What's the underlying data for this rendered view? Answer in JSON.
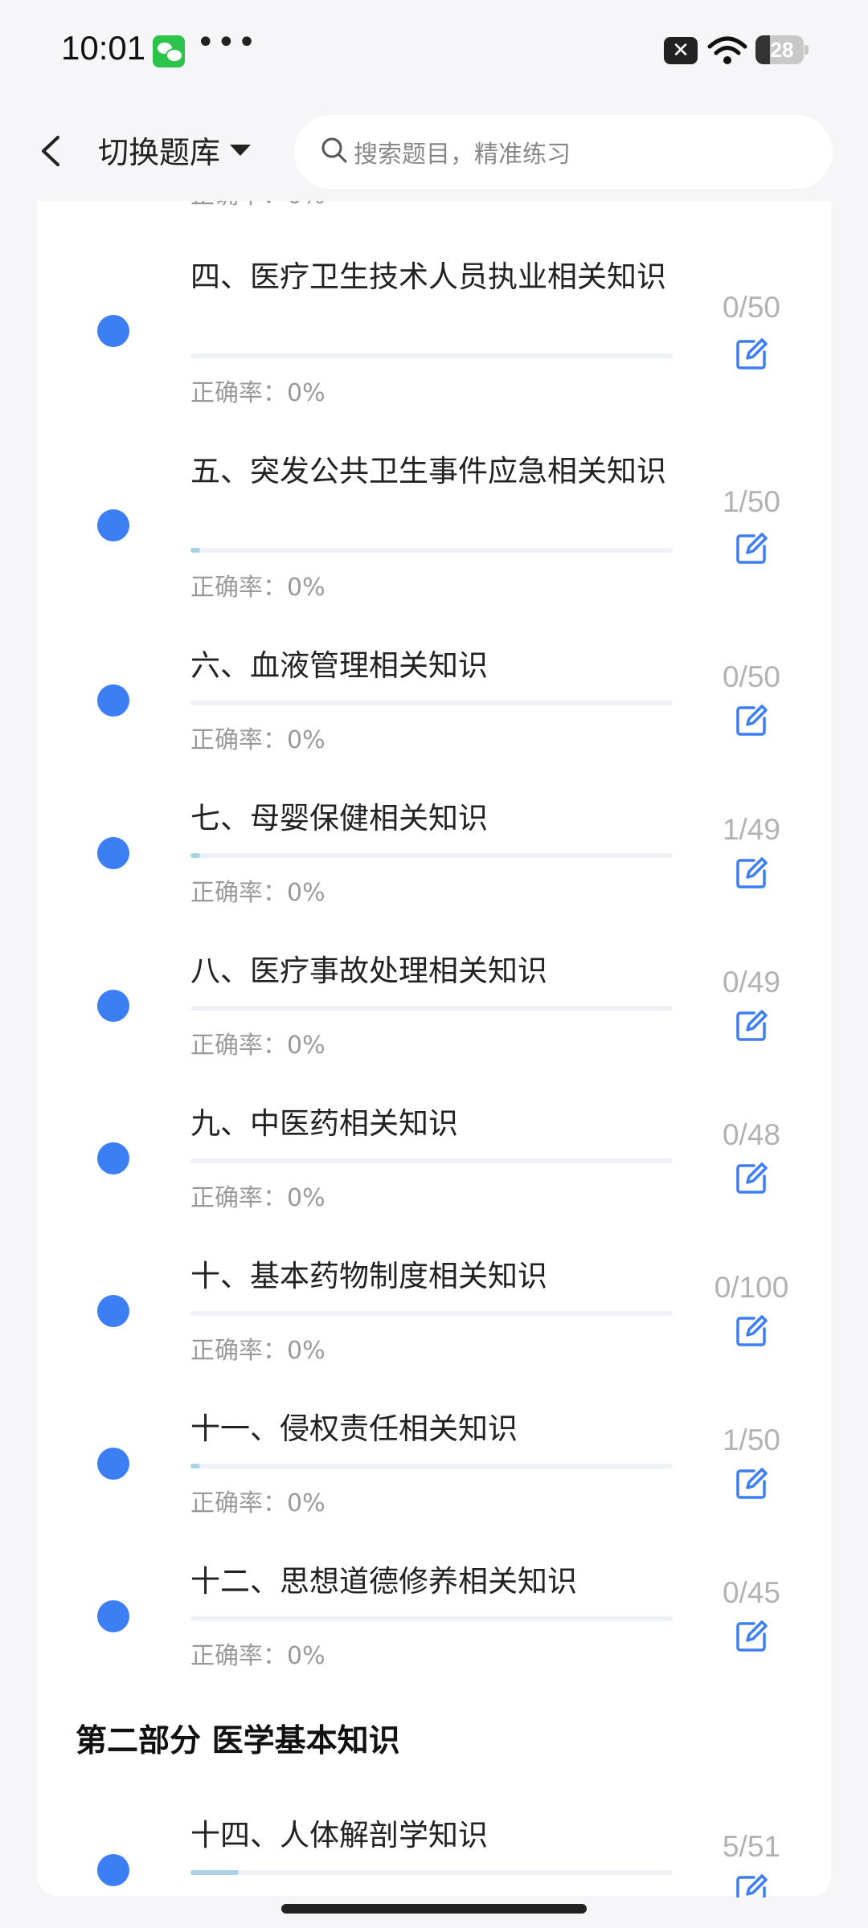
{
  "status": {
    "time": "10:01",
    "battery": "28"
  },
  "header": {
    "switch_label": "切换题库",
    "search_placeholder": "搜索题目，精准练习"
  },
  "clipped_accuracy": "正确率：0%",
  "topics": [
    {
      "title": "四、医疗卫生技术人员执业相关知识",
      "count": "0/50",
      "accuracy": "正确率：0%",
      "progress": 0
    },
    {
      "title": "五、突发公共卫生事件应急相关知识",
      "count": "1/50",
      "accuracy": "正确率：0%",
      "progress": 0.02
    },
    {
      "title": "六、血液管理相关知识",
      "count": "0/50",
      "accuracy": "正确率：0%",
      "progress": 0
    },
    {
      "title": "七、母婴保健相关知识",
      "count": "1/49",
      "accuracy": "正确率：0%",
      "progress": 0.02
    },
    {
      "title": "八、医疗事故处理相关知识",
      "count": "0/49",
      "accuracy": "正确率：0%",
      "progress": 0
    },
    {
      "title": "九、中医药相关知识",
      "count": "0/48",
      "accuracy": "正确率：0%",
      "progress": 0
    },
    {
      "title": "十、基本药物制度相关知识",
      "count": "0/100",
      "accuracy": "正确率：0%",
      "progress": 0
    },
    {
      "title": "十一、侵权责任相关知识",
      "count": "1/50",
      "accuracy": "正确率：0%",
      "progress": 0.02
    },
    {
      "title": "十二、思想道德修养相关知识",
      "count": "0/45",
      "accuracy": "正确率：0%",
      "progress": 0
    }
  ],
  "section2": {
    "title": "第二部分 医学基本知识",
    "topics": [
      {
        "title": "十四、人体解剖学知识",
        "count": "5/51",
        "progress": 0.1
      }
    ]
  }
}
